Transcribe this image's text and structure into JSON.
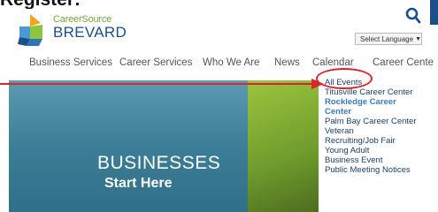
{
  "top_title": "Register:",
  "logo": {
    "line1": "CareerSource",
    "line2": "BREVARD"
  },
  "language": {
    "label": "Select Language",
    "arrow": "▼"
  },
  "nav": {
    "business_services": "Business Services",
    "career_services": "Career Services",
    "who_we_are": "Who We Are",
    "news": "News",
    "calendar": "Calendar",
    "career_centers": "Career Cente"
  },
  "hero": {
    "title": "BUSINESSES",
    "subtitle": "Start Here"
  },
  "calendar_menu": {
    "items": [
      "All Events",
      "Titusville Career Center",
      "Rockledge Career",
      "Center",
      "Palm Bay Career Center",
      "Veteran",
      "Recruiting/Job Fair",
      "Young Adult",
      "Business Event",
      "Public Meeting Notices"
    ]
  },
  "colors": {
    "brand_blue": "#1b4f8c",
    "brand_green": "#7aa33a",
    "annotation_red": "#d8262c"
  }
}
